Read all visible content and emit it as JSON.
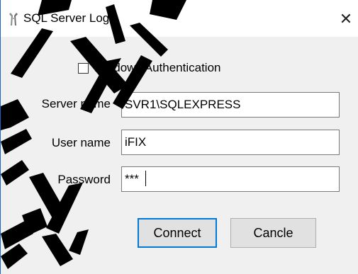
{
  "window": {
    "title": "SQL Server Login",
    "icon": "gear-wrench-icon",
    "close_glyph": "✕"
  },
  "form": {
    "windows_auth": {
      "label": "Windows Authentication",
      "checked": false
    },
    "server": {
      "label": "Server name",
      "value": "SVR1\\SQLEXPRESS"
    },
    "user": {
      "label": "User name",
      "value": "iFIX"
    },
    "password": {
      "label": "Password",
      "value": "***"
    }
  },
  "buttons": {
    "connect": "Connect",
    "cancel": "Cancle"
  },
  "colors": {
    "accent": "#0078d7",
    "watermark": "#000000"
  }
}
